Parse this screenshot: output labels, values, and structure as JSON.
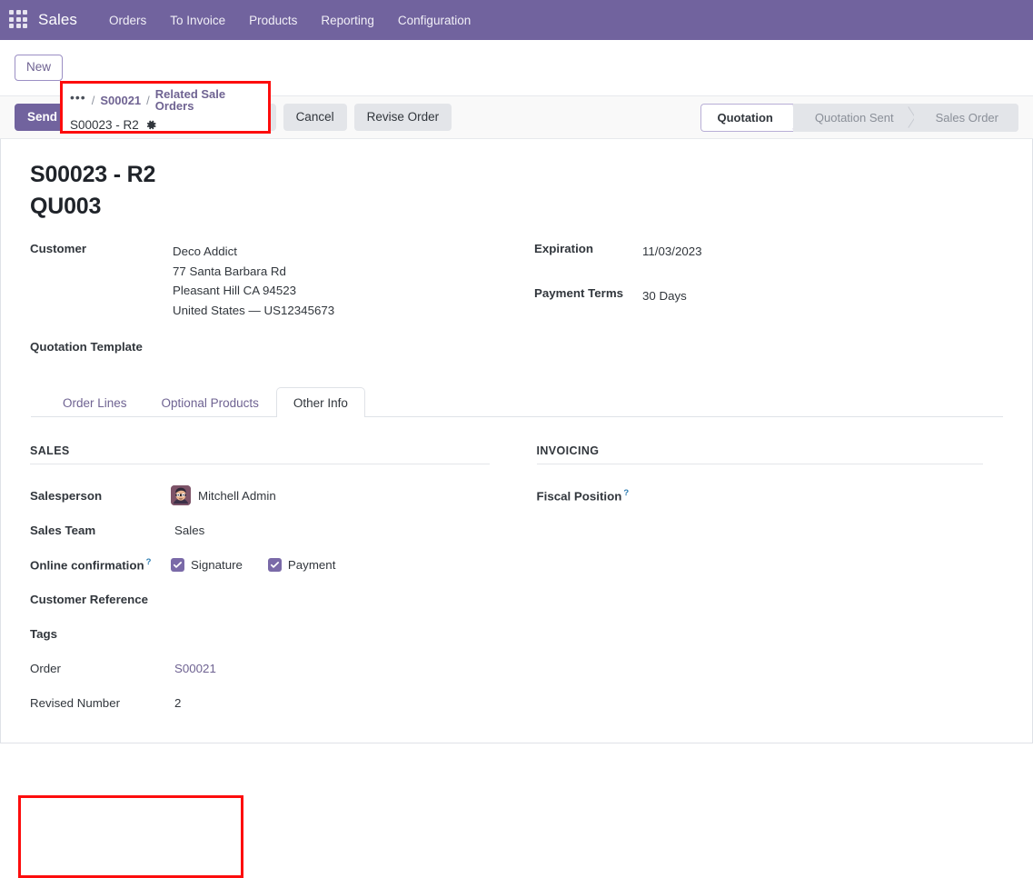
{
  "navbar": {
    "apps_icon": "apps-grid-icon",
    "brand": "Sales",
    "menu": [
      {
        "label": "Orders"
      },
      {
        "label": "To Invoice"
      },
      {
        "label": "Products"
      },
      {
        "label": "Reporting"
      },
      {
        "label": "Configuration"
      }
    ],
    "background": "#71639e"
  },
  "control_panel": {
    "new_label": "New",
    "breadcrumb": {
      "dots": "•••",
      "sep": "/",
      "parent": "S00021",
      "section": "Related Sale Orders",
      "current": "S00023 - R2",
      "gear_icon": "gear-icon"
    },
    "highlight_color": "#fd0d0d"
  },
  "statusbar": {
    "buttons": [
      {
        "label": "Send by Email",
        "style": "primary"
      },
      {
        "label": "Confirm",
        "style": "secondary"
      },
      {
        "label": "Preview",
        "style": "secondary"
      },
      {
        "label": "Cancel",
        "style": "secondary"
      },
      {
        "label": "Revise Order",
        "style": "secondary"
      }
    ],
    "pipeline": [
      {
        "label": "Quotation",
        "active": true
      },
      {
        "label": "Quotation Sent",
        "active": false
      },
      {
        "label": "Sales Order",
        "active": false
      }
    ]
  },
  "record": {
    "title_line1": "S00023 - R2",
    "title_line2": "QU003",
    "customer_label": "Customer",
    "customer_name": "Deco Addict",
    "customer_address_1": "77 Santa Barbara Rd",
    "customer_address_2": "Pleasant Hill CA 94523",
    "customer_address_3": "United States — US12345673",
    "expiration_label": "Expiration",
    "expiration_value": "11/03/2023",
    "payment_terms_label": "Payment Terms",
    "payment_terms_value": "30 Days",
    "quotation_template_label": "Quotation Template",
    "quotation_template_value": ""
  },
  "tabs": [
    {
      "label": "Order Lines",
      "active": false
    },
    {
      "label": "Optional Products",
      "active": false
    },
    {
      "label": "Other Info",
      "active": true
    }
  ],
  "other_info": {
    "sales": {
      "group_title": "SALES",
      "salesperson_label": "Salesperson",
      "salesperson_value": "Mitchell Admin",
      "salesperson_avatar": "avatar",
      "sales_team_label": "Sales Team",
      "sales_team_value": "Sales",
      "online_confirmation_label": "Online confirmation",
      "online_confirmation_help": "?",
      "signature_label": "Signature",
      "signature_checked": true,
      "payment_label": "Payment",
      "payment_checked": true,
      "customer_reference_label": "Customer Reference",
      "customer_reference_value": "",
      "tags_label": "Tags",
      "tags_value": "",
      "order_label": "Order",
      "order_value": "S00021",
      "revised_number_label": "Revised Number",
      "revised_number_value": "2"
    },
    "invoicing": {
      "group_title": "INVOICING",
      "fiscal_position_label": "Fiscal Position",
      "fiscal_position_help": "?",
      "fiscal_position_value": ""
    }
  }
}
